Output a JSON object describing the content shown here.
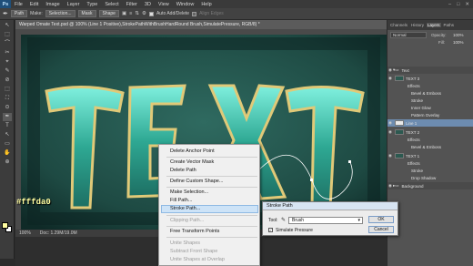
{
  "menu": {
    "logo": "Ps",
    "items": [
      "File",
      "Edit",
      "Image",
      "Layer",
      "Type",
      "Select",
      "Filter",
      "3D",
      "View",
      "Window",
      "Help"
    ],
    "window_controls": [
      "–",
      "□",
      "✕"
    ]
  },
  "options": {
    "mode_value": "Path",
    "make_label": "Make:",
    "selection_btn": "Selection...",
    "mask_btn": "Mask",
    "shape_btn": "Shape",
    "auto_add_delete": "Auto Add/Delete",
    "align_edges": "Align Edges"
  },
  "document": {
    "tab_title": "Warped Ornate Text.psd @ 100% (Line 1 Positive),StrokePathWithBrushHardRound Brush,SimulatePressure, RGB/8) *",
    "zoom": "100%",
    "doc_info": "Doc: 1.29M/19.0M",
    "canvas_text": "TEXT",
    "hex_color": "#fffda0"
  },
  "tools": [
    "↖",
    "⬚",
    "⌒",
    "✂",
    "⌖",
    "✎",
    "⊘",
    "⬚",
    "⛶",
    "⊙",
    "T",
    "↖",
    "▭",
    "✋",
    "⊕"
  ],
  "panel": {
    "tabs": [
      "Channels",
      "History",
      "Layers",
      "Paths"
    ],
    "active_tab": "Layers",
    "blend_mode": "Normal",
    "opacity_label": "Opacity:",
    "opacity_value": "100%",
    "fill_label": "Fill:",
    "fill_value": "100%",
    "layers": [
      {
        "name": "Text",
        "kind": "group"
      },
      {
        "name": "TEXT 3",
        "kind": "layer"
      },
      {
        "name": "Effects",
        "kind": "effect"
      },
      {
        "name": "Bevel & Emboss",
        "kind": "effect"
      },
      {
        "name": "Stroke",
        "kind": "effect"
      },
      {
        "name": "Inner Glow",
        "kind": "effect"
      },
      {
        "name": "Pattern Overlay",
        "kind": "effect"
      },
      {
        "name": "Line 1",
        "kind": "layer-selected"
      },
      {
        "name": "TEXT 2",
        "kind": "layer"
      },
      {
        "name": "Effects",
        "kind": "effect"
      },
      {
        "name": "Bevel & Emboss",
        "kind": "effect"
      },
      {
        "name": "TEXT 1",
        "kind": "layer"
      },
      {
        "name": "Effects",
        "kind": "effect"
      },
      {
        "name": "Stroke",
        "kind": "effect"
      },
      {
        "name": "Drop Shadow",
        "kind": "effect"
      },
      {
        "name": "Background",
        "kind": "group"
      }
    ]
  },
  "context_menu": {
    "items": [
      {
        "label": "Delete Anchor Point",
        "enabled": true
      },
      {
        "label": "Create Vector Mask",
        "enabled": true
      },
      {
        "label": "Delete Path",
        "enabled": true
      },
      {
        "label": "Define Custom Shape...",
        "enabled": true
      },
      {
        "label": "Make Selection...",
        "enabled": true
      },
      {
        "label": "Fill Path...",
        "enabled": true
      },
      {
        "label": "Stroke Path...",
        "enabled": true,
        "highlighted": true
      },
      {
        "label": "Clipping Path...",
        "enabled": false
      },
      {
        "label": "Free Transform Points",
        "enabled": true
      },
      {
        "label": "Unite Shapes",
        "enabled": false
      },
      {
        "label": "Subtract Front Shape",
        "enabled": false
      },
      {
        "label": "Unite Shapes at Overlap",
        "enabled": false
      }
    ]
  },
  "stroke_dialog": {
    "title": "Stroke Path",
    "tool_label": "Tool:",
    "tool_value": "Brush",
    "simulate_pressure": "Simulate Pressure",
    "ok": "OK",
    "cancel": "Cancel"
  },
  "colors": {
    "foreground": "#fffda0",
    "canvas": "#1f4b44",
    "letter_fill": "#3fb7a2",
    "letter_edge": "#c9b56a"
  }
}
